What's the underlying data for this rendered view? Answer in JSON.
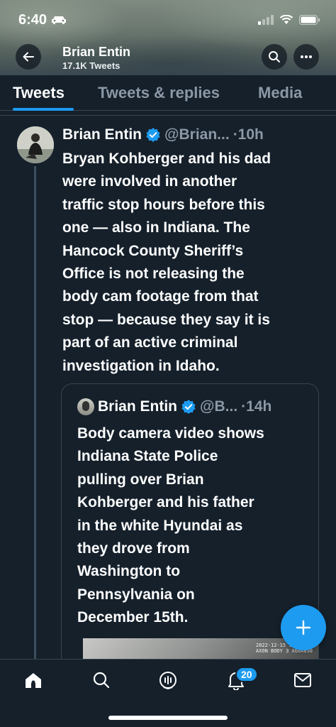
{
  "status_bar": {
    "time": "6:40"
  },
  "header": {
    "name": "Brian Entin",
    "tweet_count": "17.1K Tweets"
  },
  "tabs": [
    {
      "label": "Tweets",
      "active": true
    },
    {
      "label": "Tweets & replies",
      "active": false
    },
    {
      "label": "Media",
      "active": false
    }
  ],
  "tweet": {
    "author": "Brian Entin",
    "handle": "@Brian...",
    "time": "·10h",
    "lines": [
      "Bryan Kohberger and his dad",
      "were involved in another",
      "traffic stop hours before this",
      "one — also in Indiana. The",
      "Hancock County Sheriff’s",
      "Office is not releasing the",
      "body cam footage from that",
      "stop — because they say it is",
      "part of an active criminal",
      "investigation in Idaho."
    ]
  },
  "quote": {
    "author": "Brian Entin",
    "handle": "@B...",
    "time": "·14h",
    "lines": [
      "Body camera video shows",
      "Indiana State Police",
      "pulling over Brian",
      "Kohberger and his father",
      "in the white Hyundai as",
      "they drove from",
      "Washington to",
      "Pennsylvania on",
      "December 15th."
    ],
    "media_stamp": [
      "2022-12-15 15:50",
      "AXON BODY 3 X60A850"
    ]
  },
  "bottom_nav": {
    "notifications_badge": "20"
  },
  "colors": {
    "background": "#15202b",
    "accent": "#1d9bf0",
    "muted": "#8b98a5",
    "border": "#38444d"
  }
}
